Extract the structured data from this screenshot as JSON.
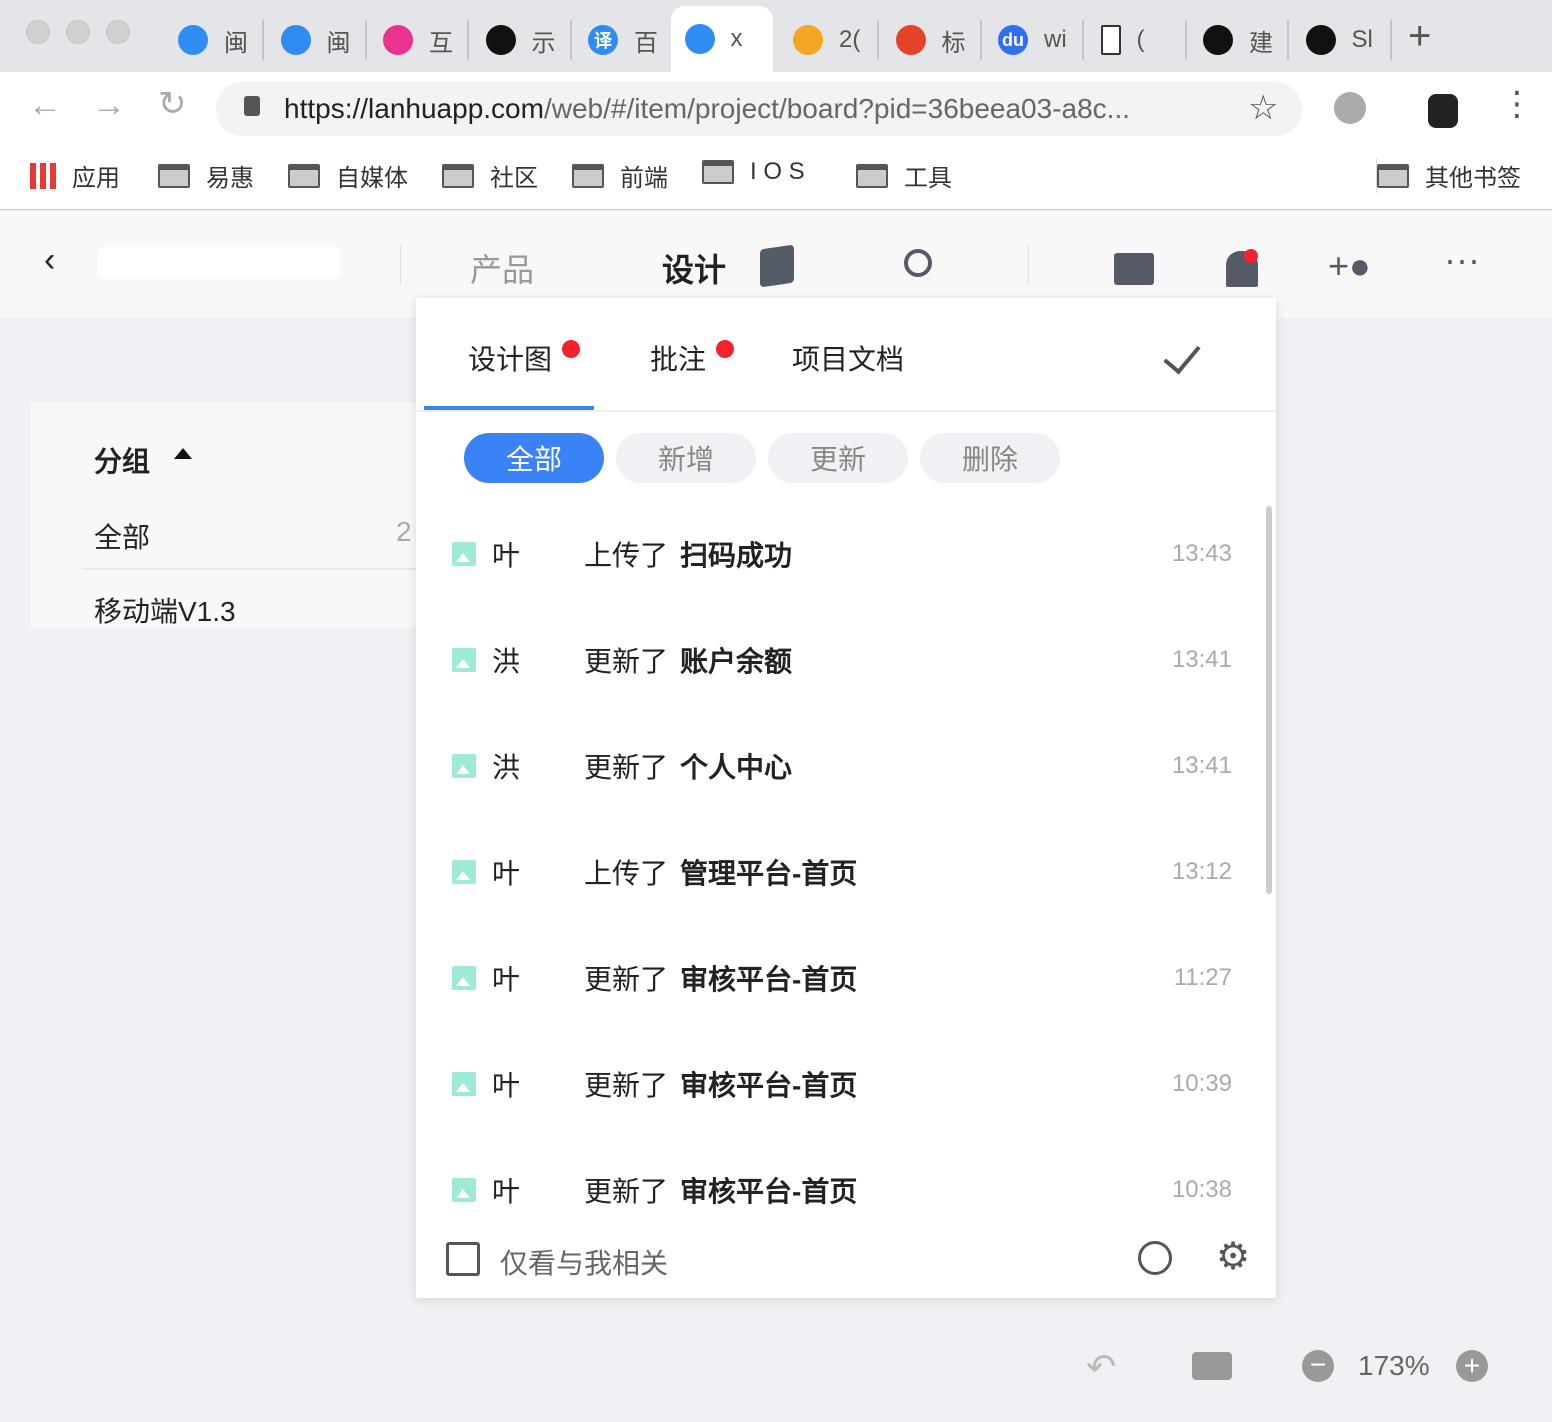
{
  "browser": {
    "tabs": [
      {
        "label": "闽",
        "color": "#2f8cf0"
      },
      {
        "label": "闽",
        "color": "#2f8cf0"
      },
      {
        "label": "互",
        "color": "#e8338f"
      },
      {
        "label": "示",
        "color": "#111111"
      },
      {
        "label": "百",
        "color": "#2f8cf0",
        "icon_text": "译"
      },
      {
        "label": "x",
        "color": "#2f8cf0",
        "active": true
      },
      {
        "label": "2(",
        "color": "#f5a623"
      },
      {
        "label": "标",
        "color": "#e24329"
      },
      {
        "label": "wi",
        "color": "#2f6ff0",
        "icon_text": "du"
      },
      {
        "label": "(",
        "color": "#ffffff"
      },
      {
        "label": "建",
        "color": "#111111"
      },
      {
        "label": "Sl",
        "color": "#111111"
      }
    ],
    "url_host": "https://lanhuapp.com",
    "url_rest": "/web/#/item/project/board?pid=36beea03-a8c...",
    "bookmarks": [
      "应用",
      "易惠",
      "自媒体",
      "社区",
      "前端",
      "I O S",
      "工具"
    ],
    "other_bookmarks": "其他书签"
  },
  "header": {
    "product": "产品",
    "design": "设计"
  },
  "sidebar": {
    "title": "分组",
    "items": [
      {
        "label": "全部",
        "count": "2"
      },
      {
        "label": "移动端V1.3",
        "count": "("
      }
    ]
  },
  "popup": {
    "tabs": [
      {
        "label": "设计图",
        "badge": true
      },
      {
        "label": "批注",
        "badge": true
      },
      {
        "label": "项目文档",
        "badge": false
      }
    ],
    "filters": [
      "全部",
      "新增",
      "更新",
      "删除"
    ],
    "active_filter": "全部",
    "rows": [
      {
        "name": "叶",
        "action": "上传了",
        "target": "扫码成功",
        "time": "13:43"
      },
      {
        "name": "洪",
        "action": "更新了",
        "target": "账户余额",
        "time": "13:41"
      },
      {
        "name": "洪",
        "action": "更新了",
        "target": "个人中心",
        "time": "13:41"
      },
      {
        "name": "叶",
        "action": "上传了",
        "target": "管理平台-首页",
        "time": "13:12"
      },
      {
        "name": "叶",
        "action": "更新了",
        "target": "审核平台-首页",
        "time": "11:27"
      },
      {
        "name": "叶",
        "action": "更新了",
        "target": "审核平台-首页",
        "time": "10:39"
      },
      {
        "name": "叶",
        "action": "更新了",
        "target": "审核平台-首页",
        "time": "10:38"
      }
    ],
    "only_mine": "仅看与我相关",
    "only_mine_checked": false
  },
  "footer": {
    "zoom": "173%"
  },
  "colors": {
    "accent": "#3a83f6",
    "badge": "#f5222d"
  }
}
